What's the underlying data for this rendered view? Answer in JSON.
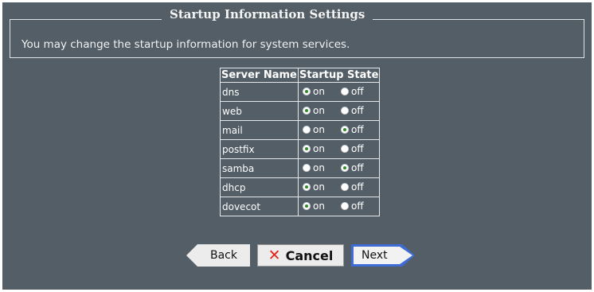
{
  "window": {
    "title": "Startup Information Settings",
    "description": "You may change the startup information for system services."
  },
  "table": {
    "headers": [
      "Server Name",
      "Startup State"
    ],
    "rows": [
      {
        "name": "dns",
        "on_label": "on",
        "off_label": "off",
        "state": "on"
      },
      {
        "name": "web",
        "on_label": "on",
        "off_label": "off",
        "state": "on"
      },
      {
        "name": "mail",
        "on_label": "on",
        "off_label": "off",
        "state": "off"
      },
      {
        "name": "postfix",
        "on_label": "on",
        "off_label": "off",
        "state": "on"
      },
      {
        "name": "samba",
        "on_label": "on",
        "off_label": "off",
        "state": "off"
      },
      {
        "name": "dhcp",
        "on_label": "on",
        "off_label": "off",
        "state": "on"
      },
      {
        "name": "dovecot",
        "on_label": "on",
        "off_label": "off",
        "state": "on"
      }
    ]
  },
  "buttons": {
    "back": "Back",
    "cancel": "Cancel",
    "next": "Next"
  },
  "colors": {
    "panel_bg": "#535e66",
    "radio_selected": "#2f8a2a",
    "next_border": "#3d6cd6",
    "cancel_icon": "#e0261d"
  }
}
